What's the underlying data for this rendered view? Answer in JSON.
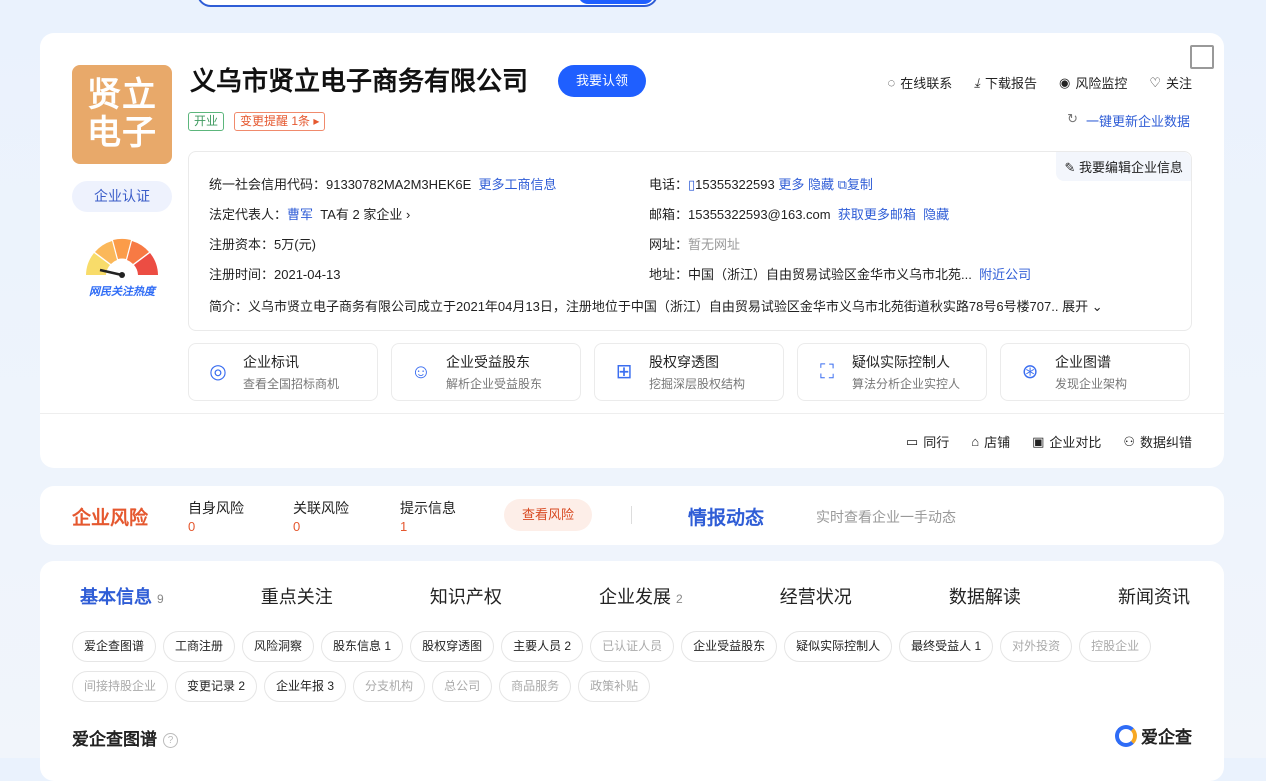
{
  "company": {
    "logo_text": "贤立电子",
    "name": "义乌市贤立电子商务有限公司",
    "claim": "我要认领",
    "status_tag": "开业",
    "change_tag": "变更提醒 1条",
    "certify": "企业认证",
    "heat_label": "网民关注热度"
  },
  "actions": [
    "在线联系",
    "下载报告",
    "风险监控",
    "关注"
  ],
  "update": "一键更新企业数据",
  "info": {
    "edit": "我要编辑企业信息",
    "credit_label": "统一社会信用代码：",
    "credit": "91330782MA2M3HEK6E",
    "credit_more": "更多工商信息",
    "legal_label": "法定代表人：",
    "legal": "曹军",
    "legal_more": "TA有 2 家企业",
    "capital_label": "注册资本：",
    "capital": "5万(元)",
    "date_label": "注册时间：",
    "date": "2021-04-13",
    "phone_label": "电话：",
    "phone": "15355322593",
    "phone_more": "更多",
    "phone_hide": "隐藏",
    "phone_copy": "复制",
    "email_label": "邮箱：",
    "email": "15355322593@163.com",
    "email_more": "获取更多邮箱",
    "email_hide": "隐藏",
    "web_label": "网址：",
    "web": "暂无网址",
    "addr_label": "地址：",
    "addr": "中国（浙江）自由贸易试验区金华市义乌市北苑...",
    "addr_more": "附近公司",
    "intro_label": "简介：",
    "intro": "义乌市贤立电子商务有限公司成立于2021年04月13日，注册地位于中国（浙江）自由贸易试验区金华市义乌市北苑街道秋实路78号6号楼707..",
    "intro_more": "展开"
  },
  "features": [
    {
      "t": "企业标讯",
      "s": "查看全国招标商机"
    },
    {
      "t": "企业受益股东",
      "s": "解析企业受益股东"
    },
    {
      "t": "股权穿透图",
      "s": "挖掘深层股权结构"
    },
    {
      "t": "疑似实际控制人",
      "s": "算法分析企业实控人"
    },
    {
      "t": "企业图谱",
      "s": "发现企业架构"
    }
  ],
  "bottom_links": [
    "同行",
    "店铺",
    "企业对比",
    "数据纠错"
  ],
  "risk": {
    "title": "企业风险",
    "items": [
      {
        "l": "自身风险",
        "v": "0"
      },
      {
        "l": "关联风险",
        "v": "0"
      },
      {
        "l": "提示信息",
        "v": "1"
      }
    ],
    "button": "查看风险",
    "intel": "情报动态",
    "intel_sub": "实时查看企业一手动态"
  },
  "tabs": [
    {
      "l": "基本信息",
      "n": "9"
    },
    {
      "l": "重点关注",
      "n": ""
    },
    {
      "l": "知识产权",
      "n": ""
    },
    {
      "l": "企业发展",
      "n": "2"
    },
    {
      "l": "经营状况",
      "n": ""
    },
    {
      "l": "数据解读",
      "n": ""
    },
    {
      "l": "新闻资讯",
      "n": ""
    }
  ],
  "chips": [
    {
      "l": "爱企查图谱",
      "d": false
    },
    {
      "l": "工商注册",
      "d": false
    },
    {
      "l": "风险洞察",
      "d": false
    },
    {
      "l": "股东信息 1",
      "d": false
    },
    {
      "l": "股权穿透图",
      "d": false
    },
    {
      "l": "主要人员 2",
      "d": false
    },
    {
      "l": "已认证人员",
      "d": true
    },
    {
      "l": "企业受益股东",
      "d": false
    },
    {
      "l": "疑似实际控制人",
      "d": false
    },
    {
      "l": "最终受益人 1",
      "d": false
    },
    {
      "l": "对外投资",
      "d": true
    },
    {
      "l": "控股企业",
      "d": true
    },
    {
      "l": "间接持股企业",
      "d": true
    },
    {
      "l": "变更记录 2",
      "d": false
    },
    {
      "l": "企业年报 3",
      "d": false
    },
    {
      "l": "分支机构",
      "d": true
    },
    {
      "l": "总公司",
      "d": true
    },
    {
      "l": "商品服务",
      "d": true
    },
    {
      "l": "政策补贴",
      "d": true
    }
  ],
  "section_title": "爱企查图谱",
  "brand": "爱企查"
}
